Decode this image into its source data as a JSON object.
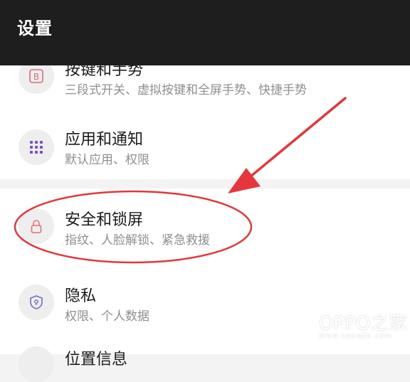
{
  "header": {
    "title": "设置"
  },
  "settings": {
    "items": [
      {
        "title": "按键和手势",
        "subtitle": "三段式开关、虚拟按键和全屏手势、快捷手势",
        "icon": "b-key-icon"
      },
      {
        "title": "应用和通知",
        "subtitle": "默认应用、权限",
        "icon": "app-grid-icon"
      },
      {
        "title": "安全和锁屏",
        "subtitle": "指纹、人脸解锁、紧急救援",
        "icon": "lock-icon"
      },
      {
        "title": "隐私",
        "subtitle": "权限、个人数据",
        "icon": "privacy-shield-icon"
      },
      {
        "title": "位置信息",
        "subtitle": "",
        "icon": "location-icon"
      }
    ]
  },
  "colors": {
    "header_bg": "#1e1e1e",
    "annotation_red": "#e5373b",
    "grid_icon": "#7a4fc9",
    "lock_icon": "#e07278",
    "shield_icon": "#6e6fc9"
  },
  "watermark": {
    "brand": "OPPO之家",
    "url": "www.oppojia.com"
  }
}
